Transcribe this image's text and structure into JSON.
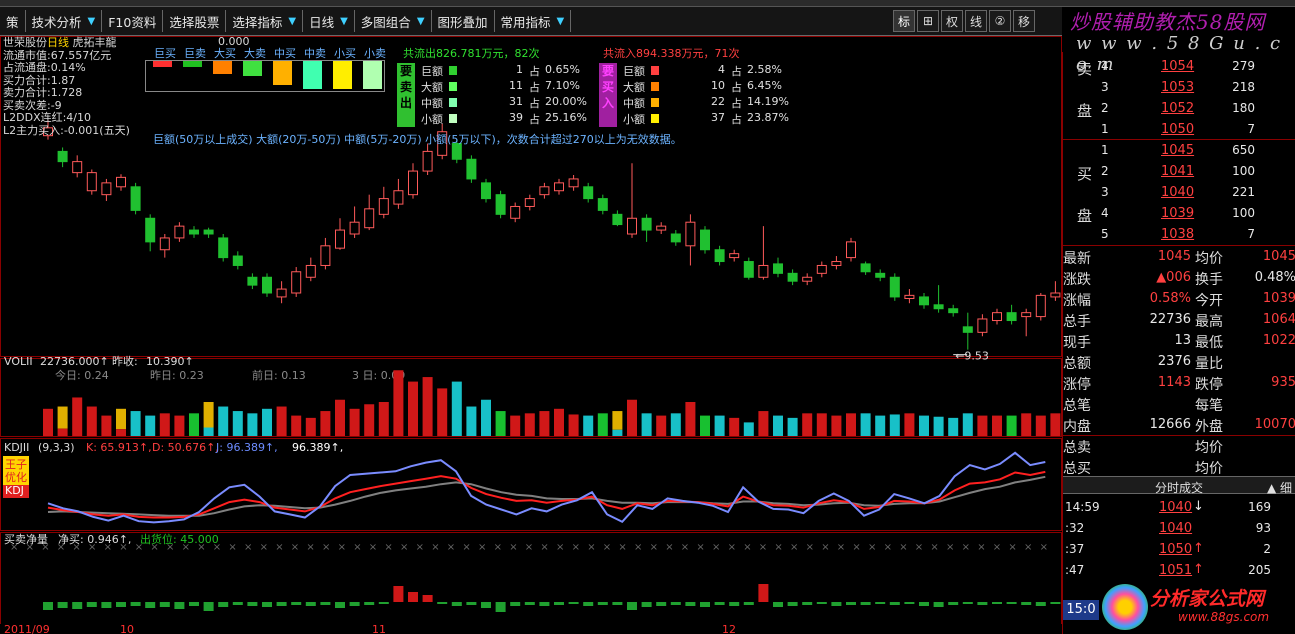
{
  "menu": {
    "items": [
      {
        "label": "策",
        "arrow": ""
      },
      {
        "label": "技术分析",
        "arrow": "▼"
      },
      {
        "label": "F10资料",
        "arrow": ""
      },
      {
        "label": "选择股票",
        "arrow": ""
      },
      {
        "label": "选择指标",
        "arrow": "▼"
      },
      {
        "label": "日线",
        "arrow": "▼"
      },
      {
        "label": "多图组合",
        "arrow": "▼"
      },
      {
        "label": "图形叠加",
        "arrow": ""
      },
      {
        "label": "常用指标",
        "arrow": "▼"
      }
    ],
    "tools": [
      "标",
      "⊞",
      "权",
      "线",
      "②",
      "移"
    ]
  },
  "watermark": {
    "brand": "炒股辅助教杰58股网",
    "url": "w w w . 5 8 G u . c o m",
    "brand2": "分析家公式网",
    "url2": "www.88gs.com"
  },
  "stock": {
    "name": "世荣股份",
    "period": "日线",
    "tag": "虎拓丰龍",
    "lines": [
      "流通市值:67.557亿元",
      "占流通盘:0.14%",
      "买力合计:1.87",
      "卖力合计:1.728",
      "买卖次差:-9",
      "L2DDX连红:4/10",
      "L2主力买入:-0.001(五天)"
    ],
    "value_top": "0.000"
  },
  "legend": {
    "labels": [
      "巨买",
      "巨卖",
      "大买",
      "大卖",
      "中买",
      "中卖",
      "小买",
      "小卖"
    ],
    "colors": [
      "#ff3030",
      "#20c020",
      "#ff8000",
      "#40e040",
      "#ffb000",
      "#40ffb0",
      "#ffee00",
      "#b0ffb0"
    ],
    "levels": [
      0.2,
      0.2,
      0.45,
      0.55,
      0.85,
      1,
      1,
      1
    ]
  },
  "flow": {
    "out_summary": "共流出826.781万元，82次",
    "in_summary": "共流入894.338万元，71次",
    "sell_tag": [
      "要",
      "卖",
      "出"
    ],
    "buy_tag": [
      "要",
      "买",
      "入"
    ],
    "rows_sell": [
      {
        "label": "巨额",
        "count": "1",
        "pct": "0.65%",
        "color": "#30d030"
      },
      {
        "label": "大额",
        "count": "11",
        "pct": "7.10%",
        "color": "#60ff60"
      },
      {
        "label": "中额",
        "count": "31",
        "pct": "20.00%",
        "color": "#80ffb0"
      },
      {
        "label": "小额",
        "count": "39",
        "pct": "25.16%",
        "color": "#c0ffc0"
      }
    ],
    "rows_buy": [
      {
        "label": "巨额",
        "count": "4",
        "pct": "2.58%",
        "color": "#ff4040"
      },
      {
        "label": "大额",
        "count": "10",
        "pct": "6.45%",
        "color": "#ff8000"
      },
      {
        "label": "中额",
        "count": "22",
        "pct": "14.19%",
        "color": "#ffb000"
      },
      {
        "label": "小额",
        "count": "37",
        "pct": "23.87%",
        "color": "#ffee00"
      }
    ],
    "zhan": "占"
  },
  "note": "巨额(50万以上成交) 大额(20万-50万) 中额(5万-20万) 小额(5万以下)，次数合计超过270以上为无效数据。",
  "low_mark": "9.53",
  "vol": {
    "title": "VOLII",
    "value": "22736.000↑",
    "prev_label": "昨收:",
    "prev": "10.390↑",
    "items": [
      "今日: 0.24",
      "昨日: 0.23",
      "前日: 0.13",
      "3 日: 0.09"
    ]
  },
  "kdj": {
    "title": "KDJII",
    "params": "(9,3,3)",
    "k": "K: 65.913↑,",
    "d": "D: 50.676↑,",
    "j": "J: 96.389↑,",
    "j2": "96.389↑,",
    "tag": [
      "王子",
      "优化",
      "KDJ"
    ]
  },
  "net": {
    "title": "买卖净量",
    "value": "净买: 0.946↑,",
    "chip": "出货位: 45.000"
  },
  "dates": [
    "2011/09",
    "10",
    "11",
    "12"
  ],
  "orderbook": {
    "sell_label": [
      "卖",
      "盘"
    ],
    "buy_label": [
      "买",
      "盘"
    ],
    "sell": [
      {
        "lvl": "4",
        "price": "1054",
        "vol": "279"
      },
      {
        "lvl": "3",
        "price": "1053",
        "vol": "218"
      },
      {
        "lvl": "2",
        "price": "1052",
        "vol": "180"
      },
      {
        "lvl": "1",
        "price": "1050",
        "vol": "7"
      }
    ],
    "buy": [
      {
        "lvl": "1",
        "price": "1045",
        "vol": "650"
      },
      {
        "lvl": "2",
        "price": "1041",
        "vol": "100"
      },
      {
        "lvl": "3",
        "price": "1040",
        "vol": "221"
      },
      {
        "lvl": "4",
        "price": "1039",
        "vol": "100"
      },
      {
        "lvl": "5",
        "price": "1038",
        "vol": "7"
      }
    ]
  },
  "quote": [
    {
      "l1": "最新",
      "v1": "1045",
      "c1": "red",
      "l2": "均价",
      "v2": "1045",
      "c2": "red"
    },
    {
      "l1": "涨跌",
      "v1": "▲006",
      "c1": "red",
      "l2": "换手",
      "v2": "0.48%",
      "c2": "wht"
    },
    {
      "l1": "涨幅",
      "v1": "0.58%",
      "c1": "red",
      "l2": "今开",
      "v2": "1039",
      "c2": "red"
    },
    {
      "l1": "总手",
      "v1": "22736",
      "c1": "wht",
      "l2": "最高",
      "v2": "1064",
      "c2": "red"
    },
    {
      "l1": "现手",
      "v1": "13",
      "c1": "wht",
      "l2": "最低",
      "v2": "1022",
      "c2": "red"
    },
    {
      "l1": "总额",
      "v1": "2376",
      "c1": "wht",
      "l2": "量比",
      "v2": "",
      "c2": "wht"
    },
    {
      "l1": "涨停",
      "v1": "1143",
      "c1": "red",
      "l2": "跌停",
      "v2": "935",
      "c2": "red"
    },
    {
      "l1": "总笔",
      "v1": "",
      "c1": "wht",
      "l2": "每笔",
      "v2": "",
      "c2": "wht"
    },
    {
      "l1": "内盘",
      "v1": "12666",
      "c1": "wht",
      "l2": "外盘",
      "v2": "10070",
      "c2": "red"
    },
    {
      "l1": "总卖",
      "v1": "",
      "c1": "wht",
      "l2": "均价",
      "v2": "",
      "c2": "wht"
    },
    {
      "l1": "总买",
      "v1": "",
      "c1": "wht",
      "l2": "均价",
      "v2": "",
      "c2": "wht"
    }
  ],
  "ticks_header": "分时成交",
  "ticks_header_right": "▲ 细",
  "ticks": [
    {
      "t": "14:59",
      "p": "1040",
      "arr": "↓",
      "arrc": "wht",
      "v": "169"
    },
    {
      "t": ":32",
      "p": "1040",
      "arr": "",
      "arrc": "wht",
      "v": "93"
    },
    {
      "t": ":37",
      "p": "1050",
      "arr": "↑",
      "arrc": "red",
      "v": "2"
    },
    {
      "t": ":47",
      "p": "1051",
      "arr": "↑",
      "arrc": "red",
      "v": "205"
    }
  ],
  "clock": "15:0",
  "chart_data": {
    "type": "candlestick",
    "price_unit": "raw",
    "candles": [
      {
        "o": 12.25,
        "c": 12.35,
        "h": 12.45,
        "l": 12.2
      },
      {
        "o": 12.05,
        "c": 11.92,
        "h": 12.1,
        "l": 11.85
      },
      {
        "o": 11.78,
        "c": 11.92,
        "h": 12.0,
        "l": 11.72
      },
      {
        "o": 11.55,
        "c": 11.78,
        "h": 11.82,
        "l": 11.5
      },
      {
        "o": 11.5,
        "c": 11.65,
        "h": 11.7,
        "l": 11.42
      },
      {
        "o": 11.6,
        "c": 11.72,
        "h": 11.76,
        "l": 11.55
      },
      {
        "o": 11.6,
        "c": 11.3,
        "h": 11.65,
        "l": 11.25
      },
      {
        "o": 11.2,
        "c": 10.9,
        "h": 11.25,
        "l": 10.78
      },
      {
        "o": 10.8,
        "c": 10.95,
        "h": 11.0,
        "l": 10.7
      },
      {
        "o": 10.95,
        "c": 11.1,
        "h": 11.15,
        "l": 10.9
      },
      {
        "o": 11.05,
        "c": 11.0,
        "h": 11.1,
        "l": 10.95
      },
      {
        "o": 11.05,
        "c": 11.0,
        "h": 11.08,
        "l": 10.95
      },
      {
        "o": 10.95,
        "c": 10.7,
        "h": 11.0,
        "l": 10.65
      },
      {
        "o": 10.72,
        "c": 10.6,
        "h": 10.78,
        "l": 10.55
      },
      {
        "o": 10.45,
        "c": 10.35,
        "h": 10.5,
        "l": 10.3
      },
      {
        "o": 10.45,
        "c": 10.25,
        "h": 10.5,
        "l": 10.2
      },
      {
        "o": 10.2,
        "c": 10.3,
        "h": 10.4,
        "l": 10.12
      },
      {
        "o": 10.25,
        "c": 10.52,
        "h": 10.58,
        "l": 10.2
      },
      {
        "o": 10.45,
        "c": 10.6,
        "h": 10.7,
        "l": 10.4
      },
      {
        "o": 10.6,
        "c": 10.85,
        "h": 10.95,
        "l": 10.55
      },
      {
        "o": 10.82,
        "c": 11.05,
        "h": 11.2,
        "l": 10.8
      },
      {
        "o": 11.0,
        "c": 11.15,
        "h": 11.35,
        "l": 10.95
      },
      {
        "o": 11.08,
        "c": 11.32,
        "h": 11.5,
        "l": 11.05
      },
      {
        "o": 11.25,
        "c": 11.45,
        "h": 11.6,
        "l": 11.2
      },
      {
        "o": 11.38,
        "c": 11.55,
        "h": 11.7,
        "l": 11.32
      },
      {
        "o": 11.5,
        "c": 11.8,
        "h": 11.9,
        "l": 11.45
      },
      {
        "o": 11.8,
        "c": 12.05,
        "h": 12.15,
        "l": 11.75
      },
      {
        "o": 12.0,
        "c": 12.3,
        "h": 12.4,
        "l": 11.95
      },
      {
        "o": 12.15,
        "c": 11.95,
        "h": 12.2,
        "l": 11.9
      },
      {
        "o": 11.95,
        "c": 11.7,
        "h": 12.0,
        "l": 11.65
      },
      {
        "o": 11.65,
        "c": 11.45,
        "h": 11.7,
        "l": 11.4
      },
      {
        "o": 11.5,
        "c": 11.25,
        "h": 11.55,
        "l": 11.2
      },
      {
        "o": 11.2,
        "c": 11.35,
        "h": 11.4,
        "l": 11.15
      },
      {
        "o": 11.35,
        "c": 11.45,
        "h": 11.5,
        "l": 11.3
      },
      {
        "o": 11.5,
        "c": 11.6,
        "h": 11.65,
        "l": 11.45
      },
      {
        "o": 11.55,
        "c": 11.65,
        "h": 11.7,
        "l": 11.5
      },
      {
        "o": 11.6,
        "c": 11.7,
        "h": 11.75,
        "l": 11.55
      },
      {
        "o": 11.6,
        "c": 11.45,
        "h": 11.65,
        "l": 11.4
      },
      {
        "o": 11.45,
        "c": 11.3,
        "h": 11.5,
        "l": 11.25
      },
      {
        "o": 11.25,
        "c": 11.12,
        "h": 11.3,
        "l": 11.1
      },
      {
        "o": 11.0,
        "c": 11.2,
        "h": 11.9,
        "l": 10.95
      },
      {
        "o": 11.2,
        "c": 11.05,
        "h": 11.25,
        "l": 10.9
      },
      {
        "o": 11.05,
        "c": 11.1,
        "h": 11.15,
        "l": 11.0
      },
      {
        "o": 11.0,
        "c": 10.9,
        "h": 11.05,
        "l": 10.85
      },
      {
        "o": 10.85,
        "c": 11.15,
        "h": 11.25,
        "l": 10.6
      },
      {
        "o": 11.05,
        "c": 10.8,
        "h": 11.1,
        "l": 10.75
      },
      {
        "o": 10.8,
        "c": 10.65,
        "h": 10.85,
        "l": 10.6
      },
      {
        "o": 10.7,
        "c": 10.75,
        "h": 10.8,
        "l": 10.65
      },
      {
        "o": 10.65,
        "c": 10.45,
        "h": 10.7,
        "l": 10.42
      },
      {
        "o": 10.45,
        "c": 10.6,
        "h": 11.1,
        "l": 10.42
      },
      {
        "o": 10.62,
        "c": 10.5,
        "h": 10.7,
        "l": 10.45
      },
      {
        "o": 10.5,
        "c": 10.4,
        "h": 10.55,
        "l": 10.35
      },
      {
        "o": 10.4,
        "c": 10.45,
        "h": 10.5,
        "l": 10.35
      },
      {
        "o": 10.5,
        "c": 10.6,
        "h": 10.65,
        "l": 10.45
      },
      {
        "o": 10.6,
        "c": 10.65,
        "h": 10.72,
        "l": 10.55
      },
      {
        "o": 10.7,
        "c": 10.9,
        "h": 10.95,
        "l": 10.65
      },
      {
        "o": 10.62,
        "c": 10.52,
        "h": 10.65,
        "l": 10.48
      },
      {
        "o": 10.5,
        "c": 10.45,
        "h": 10.55,
        "l": 10.4
      },
      {
        "o": 10.45,
        "c": 10.2,
        "h": 10.5,
        "l": 10.15
      },
      {
        "o": 10.18,
        "c": 10.22,
        "h": 10.3,
        "l": 10.12
      },
      {
        "o": 10.2,
        "c": 10.1,
        "h": 10.25,
        "l": 10.05
      },
      {
        "o": 10.1,
        "c": 10.05,
        "h": 10.35,
        "l": 10.0
      },
      {
        "o": 10.05,
        "c": 10.0,
        "h": 10.1,
        "l": 9.95
      },
      {
        "o": 9.82,
        "c": 9.75,
        "h": 10.0,
        "l": 9.53
      },
      {
        "o": 9.75,
        "c": 9.92,
        "h": 9.98,
        "l": 9.7
      },
      {
        "o": 9.9,
        "c": 10.0,
        "h": 10.05,
        "l": 9.85
      },
      {
        "o": 10.0,
        "c": 9.9,
        "h": 10.1,
        "l": 9.85
      },
      {
        "o": 9.95,
        "c": 10.0,
        "h": 10.05,
        "l": 9.7
      },
      {
        "o": 9.95,
        "c": 10.22,
        "h": 10.25,
        "l": 9.9
      },
      {
        "o": 10.2,
        "c": 10.25,
        "h": 10.4,
        "l": 10.15
      }
    ],
    "volume": [
      120,
      130,
      170,
      130,
      90,
      120,
      110,
      90,
      100,
      90,
      100,
      150,
      130,
      110,
      100,
      120,
      130,
      90,
      80,
      110,
      160,
      120,
      140,
      150,
      290,
      240,
      260,
      210,
      240,
      130,
      160,
      110,
      90,
      100,
      110,
      120,
      95,
      90,
      100,
      110,
      160,
      100,
      90,
      100,
      150,
      90,
      90,
      80,
      60,
      110,
      90,
      80,
      100,
      100,
      90,
      100,
      100,
      90,
      95,
      100,
      90,
      85,
      80,
      100,
      90,
      90,
      90,
      100,
      90,
      100
    ],
    "volume_up": [
      1,
      1,
      1,
      1,
      1,
      1,
      0,
      0,
      1,
      1,
      0,
      0,
      0,
      0,
      0,
      0,
      1,
      1,
      1,
      1,
      1,
      1,
      1,
      1,
      1,
      1,
      1,
      1,
      0,
      0,
      0,
      0,
      1,
      1,
      1,
      1,
      1,
      0,
      0,
      0,
      1,
      0,
      1,
      0,
      1,
      0,
      0,
      1,
      0,
      1,
      0,
      0,
      1,
      1,
      1,
      1,
      0,
      0,
      0,
      1,
      0,
      0,
      0,
      0,
      1,
      1,
      0,
      1,
      1,
      1
    ],
    "volume_gold": [
      0,
      1,
      0,
      0,
      0,
      1,
      0,
      0,
      0,
      0,
      0,
      1,
      0,
      0,
      0,
      0,
      0,
      0,
      0,
      0,
      0,
      0,
      0,
      0,
      0,
      0,
      0,
      0,
      0,
      0,
      0,
      0,
      0,
      0,
      0,
      0,
      0,
      0,
      0,
      1,
      0,
      0,
      0,
      0,
      0,
      0,
      0,
      0,
      0,
      0,
      0,
      0,
      0,
      0,
      0,
      0,
      0,
      0,
      0,
      0,
      0,
      0,
      0,
      0,
      0,
      0,
      0,
      0,
      0,
      0
    ],
    "kdj": {
      "k": [
        33,
        29,
        26,
        22,
        20,
        22,
        18,
        17,
        17,
        18,
        22,
        32,
        42,
        46,
        42,
        33,
        30,
        27,
        34,
        48,
        58,
        63,
        68,
        72,
        76,
        80,
        84,
        80,
        65,
        55,
        49,
        44,
        45,
        41,
        44,
        46,
        51,
        37,
        31,
        40,
        37,
        44,
        43,
        42,
        39,
        35,
        51,
        43,
        37,
        36,
        33,
        40,
        45,
        42,
        31,
        34,
        44,
        43,
        40,
        46,
        61,
        72,
        74,
        79,
        90,
        86,
        91
      ],
      "d": [
        26,
        27,
        26,
        25,
        24,
        23,
        22,
        21,
        20,
        20,
        20,
        24,
        30,
        35,
        37,
        36,
        34,
        32,
        33,
        38,
        44,
        51,
        57,
        61,
        64,
        67,
        71,
        74,
        71,
        64,
        58,
        54,
        52,
        48,
        47,
        47,
        48,
        44,
        41,
        41,
        40,
        42,
        42,
        42,
        40,
        39,
        43,
        43,
        40,
        39,
        37,
        38,
        40,
        41,
        37,
        36,
        39,
        40,
        40,
        43,
        50,
        57,
        63,
        67,
        74,
        78,
        83
      ],
      "j": [
        40,
        32,
        27,
        18,
        12,
        20,
        11,
        9,
        11,
        14,
        26,
        48,
        66,
        70,
        51,
        27,
        22,
        17,
        35,
        68,
        86,
        88,
        90,
        92,
        100,
        106,
        110,
        92,
        52,
        38,
        30,
        22,
        32,
        27,
        38,
        45,
        58,
        22,
        10,
        37,
        31,
        48,
        44,
        41,
        36,
        26,
        66,
        43,
        31,
        30,
        24,
        44,
        56,
        44,
        20,
        30,
        55,
        48,
        40,
        52,
        84,
        102,
        95,
        104,
        122,
        102,
        107
      ]
    },
    "net": [
      -8,
      -6,
      -7,
      -5,
      -6,
      -5,
      -4,
      -6,
      -5,
      -7,
      -4,
      -9,
      -5,
      -3,
      -4,
      -5,
      -4,
      -3,
      -4,
      -3,
      -6,
      -4,
      -3,
      -2,
      16,
      10,
      7,
      -2,
      -4,
      -3,
      -6,
      -10,
      -4,
      -3,
      -4,
      -3,
      -2,
      -4,
      -3,
      -3,
      -8,
      -5,
      -4,
      -3,
      -4,
      -5,
      -3,
      -4,
      -3,
      18,
      -5,
      -4,
      -3,
      -2,
      -4,
      -3,
      -3,
      -2,
      -3,
      -2,
      -4,
      -5,
      -3,
      -2,
      -3,
      -2,
      -2,
      -3,
      -4,
      -2
    ]
  }
}
